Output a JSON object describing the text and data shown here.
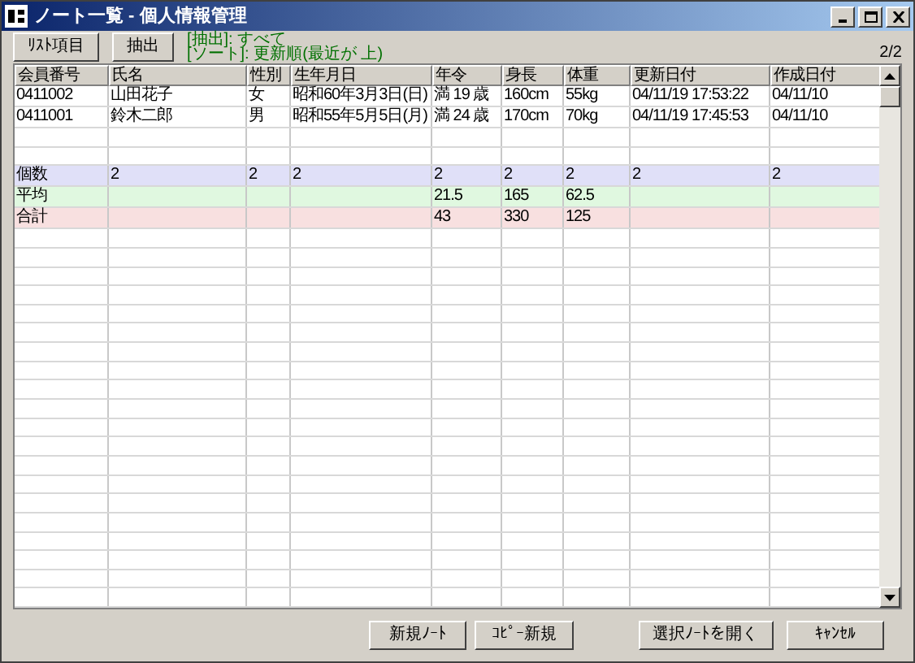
{
  "window": {
    "title": "ノート一覧 - 個人情報管理"
  },
  "toolbar": {
    "buttons": [
      "ﾘｽﾄ項目",
      "抽出"
    ],
    "filter_line": "[抽出]: すべて",
    "sort_line": "[ソート]:  更新順(最近が 上)",
    "page_count": "2/2"
  },
  "table": {
    "columns": [
      "会員番号",
      "氏名",
      "性別",
      "生年月日",
      "年令",
      "身長",
      "体重",
      "更新日付",
      "作成日付"
    ],
    "rows": [
      {
        "cells": [
          "0411002",
          "山田花子",
          "女",
          "昭和60年3月3日(日)",
          "満 19 歳",
          "160cm",
          "55kg",
          "04/11/19 17:53:22",
          "04/11/10"
        ]
      },
      {
        "cells": [
          "0411001",
          "鈴木二郎",
          "男",
          "昭和55年5月5日(月)",
          "満 24 歳",
          "170cm",
          "70kg",
          "04/11/19 17:45:53",
          "04/11/10"
        ]
      }
    ],
    "summary_rows": [
      {
        "color": "#e0e0f8",
        "cells": [
          "個数",
          "2",
          "2",
          "2",
          "2",
          "2",
          "2",
          "2",
          "2"
        ]
      },
      {
        "color": "#e0f8e0",
        "cells": [
          "平均",
          null,
          null,
          null,
          "21.5",
          "165",
          "62.5",
          null,
          null
        ]
      },
      {
        "color": "#f8e0e0",
        "cells": [
          "合計",
          null,
          null,
          null,
          "43",
          "330",
          "125",
          null,
          null
        ]
      }
    ]
  },
  "footer": {
    "buttons": [
      "新規ﾉｰﾄ",
      "ｺﾋﾟｰ新規",
      "選択ﾉｰﾄを開く",
      "ｷｬﾝｾﾙ"
    ]
  }
}
